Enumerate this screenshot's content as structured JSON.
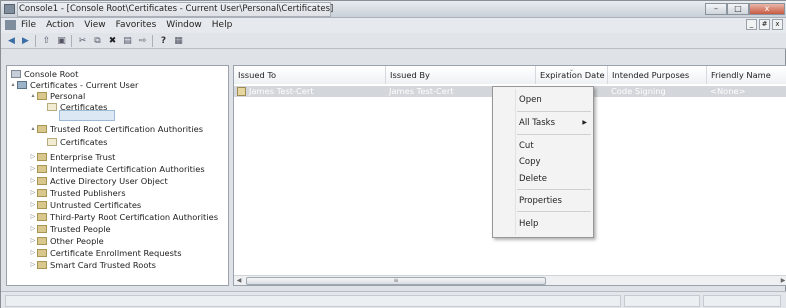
{
  "window": {
    "title": "Console1 - [Console Root\\Certificates - Current User\\Personal\\Certificates]",
    "buttons": {
      "minimize": "–",
      "maximize": "□",
      "close": "x"
    }
  },
  "menu": {
    "items": [
      "File",
      "Action",
      "View",
      "Favorites",
      "Window",
      "Help"
    ],
    "mdi": [
      "_",
      "#",
      "x"
    ]
  },
  "toolbar": {
    "buttons": [
      "back-icon",
      "forward-icon",
      "up-icon",
      "show-tree-icon",
      "cut-icon",
      "copy-icon",
      "delete-icon",
      "properties-icon",
      "export-icon",
      "help-icon",
      "action-pane-icon"
    ]
  },
  "tree": {
    "nodes": [
      {
        "label": "Console Root",
        "icon": "root-icon",
        "level": 0,
        "arrow": ""
      },
      {
        "label": "Certificates - Current User",
        "icon": "certificates-snapin-icon",
        "level": 0,
        "arrow": "▴"
      },
      {
        "label": "Personal",
        "icon": "folder-icon",
        "level": 1,
        "arrow": "▴"
      },
      {
        "label": "Certificates",
        "icon": "certificate-folder-icon",
        "level": 2,
        "arrow": ""
      },
      {
        "label": "Trusted Root Certification Authorities",
        "icon": "folder-icon",
        "level": 1,
        "arrow": "▴"
      },
      {
        "label": "Certificates",
        "icon": "certificate-folder-icon",
        "level": 2,
        "arrow": ""
      },
      {
        "label": "Enterprise Trust",
        "icon": "folder-icon",
        "level": 1,
        "arrow": "▷"
      },
      {
        "label": "Intermediate Certification Authorities",
        "icon": "folder-icon",
        "level": 1,
        "arrow": "▷"
      },
      {
        "label": "Active Directory User Object",
        "icon": "folder-icon",
        "level": 1,
        "arrow": "▷"
      },
      {
        "label": "Trusted Publishers",
        "icon": "folder-icon",
        "level": 1,
        "arrow": "▷"
      },
      {
        "label": "Untrusted Certificates",
        "icon": "folder-icon",
        "level": 1,
        "arrow": "▷"
      },
      {
        "label": "Third-Party Root Certification Authorities",
        "icon": "folder-icon",
        "level": 1,
        "arrow": "▷"
      },
      {
        "label": "Trusted People",
        "icon": "folder-icon",
        "level": 1,
        "arrow": "▷"
      },
      {
        "label": "Other People",
        "icon": "folder-icon",
        "level": 1,
        "arrow": "▷"
      },
      {
        "label": "Certificate Enrollment Requests",
        "icon": "folder-icon",
        "level": 1,
        "arrow": "▷"
      },
      {
        "label": "Smart Card Trusted Roots",
        "icon": "folder-icon",
        "level": 1,
        "arrow": "▷"
      }
    ]
  },
  "list": {
    "columns": [
      "Issued To",
      "Issued By",
      "Expiration Date",
      "Intended Purposes",
      "Friendly Name"
    ],
    "rows": [
      {
        "issued_to": "James Test-Cert",
        "issued_by": "James Test-Cert",
        "expiration": "",
        "purposes": "Code Signing",
        "friendly_name": "<None>"
      }
    ]
  },
  "context_menu": {
    "items": [
      "Open",
      "All Tasks",
      "Cut",
      "Copy",
      "Delete",
      "Properties",
      "Help"
    ]
  }
}
